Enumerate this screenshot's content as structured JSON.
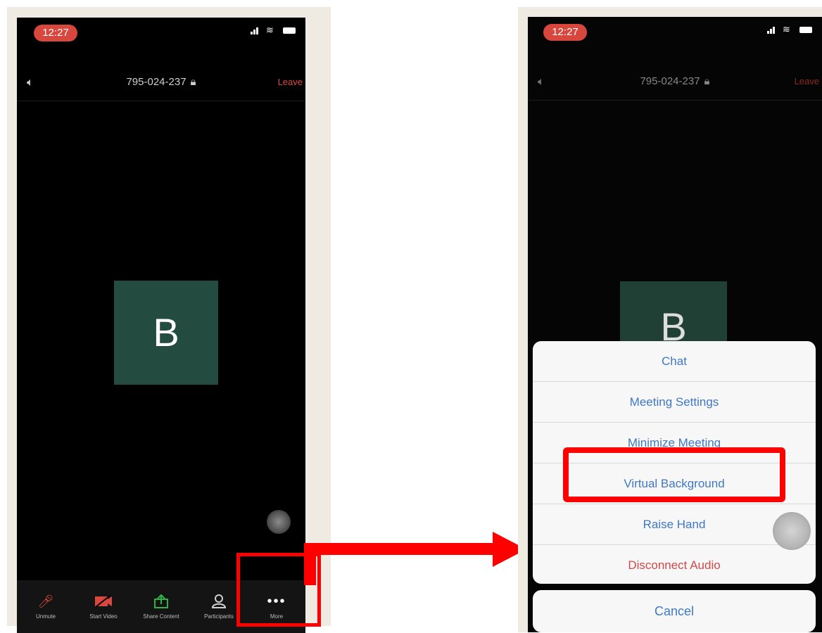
{
  "left_phone": {
    "status": {
      "time": "12:27"
    },
    "header": {
      "meeting_id": "795-024-237",
      "leave_label": "Leave"
    },
    "avatar_letter": "B",
    "toolbar": [
      {
        "label": "Unmute",
        "icon": "mic-muted-icon",
        "color": "#d9483d"
      },
      {
        "label": "Start Video",
        "icon": "video-off-icon",
        "color": "#d9483d"
      },
      {
        "label": "Share Content",
        "icon": "share-icon",
        "color": "#2fb24a"
      },
      {
        "label": "Participants",
        "icon": "participants-icon",
        "color": "#cfcfcf"
      },
      {
        "label": "More",
        "icon": "more-icon",
        "color": "#ffffff"
      }
    ]
  },
  "right_phone": {
    "status": {
      "time": "12:27"
    },
    "header": {
      "meeting_id": "795-024-237",
      "leave_label": "Leave"
    },
    "avatar_letter": "B",
    "menu": [
      {
        "label": "Chat"
      },
      {
        "label": "Meeting Settings"
      },
      {
        "label": "Minimize Meeting"
      },
      {
        "label": "Virtual Background"
      },
      {
        "label": "Raise Hand"
      },
      {
        "label": "Disconnect Audio"
      }
    ],
    "cancel_label": "Cancel"
  },
  "colors": {
    "highlight": "#ff0000",
    "menu_text": "#3f78c5",
    "danger_text": "#d14a4a",
    "avatar_bg": "#244b3f"
  }
}
